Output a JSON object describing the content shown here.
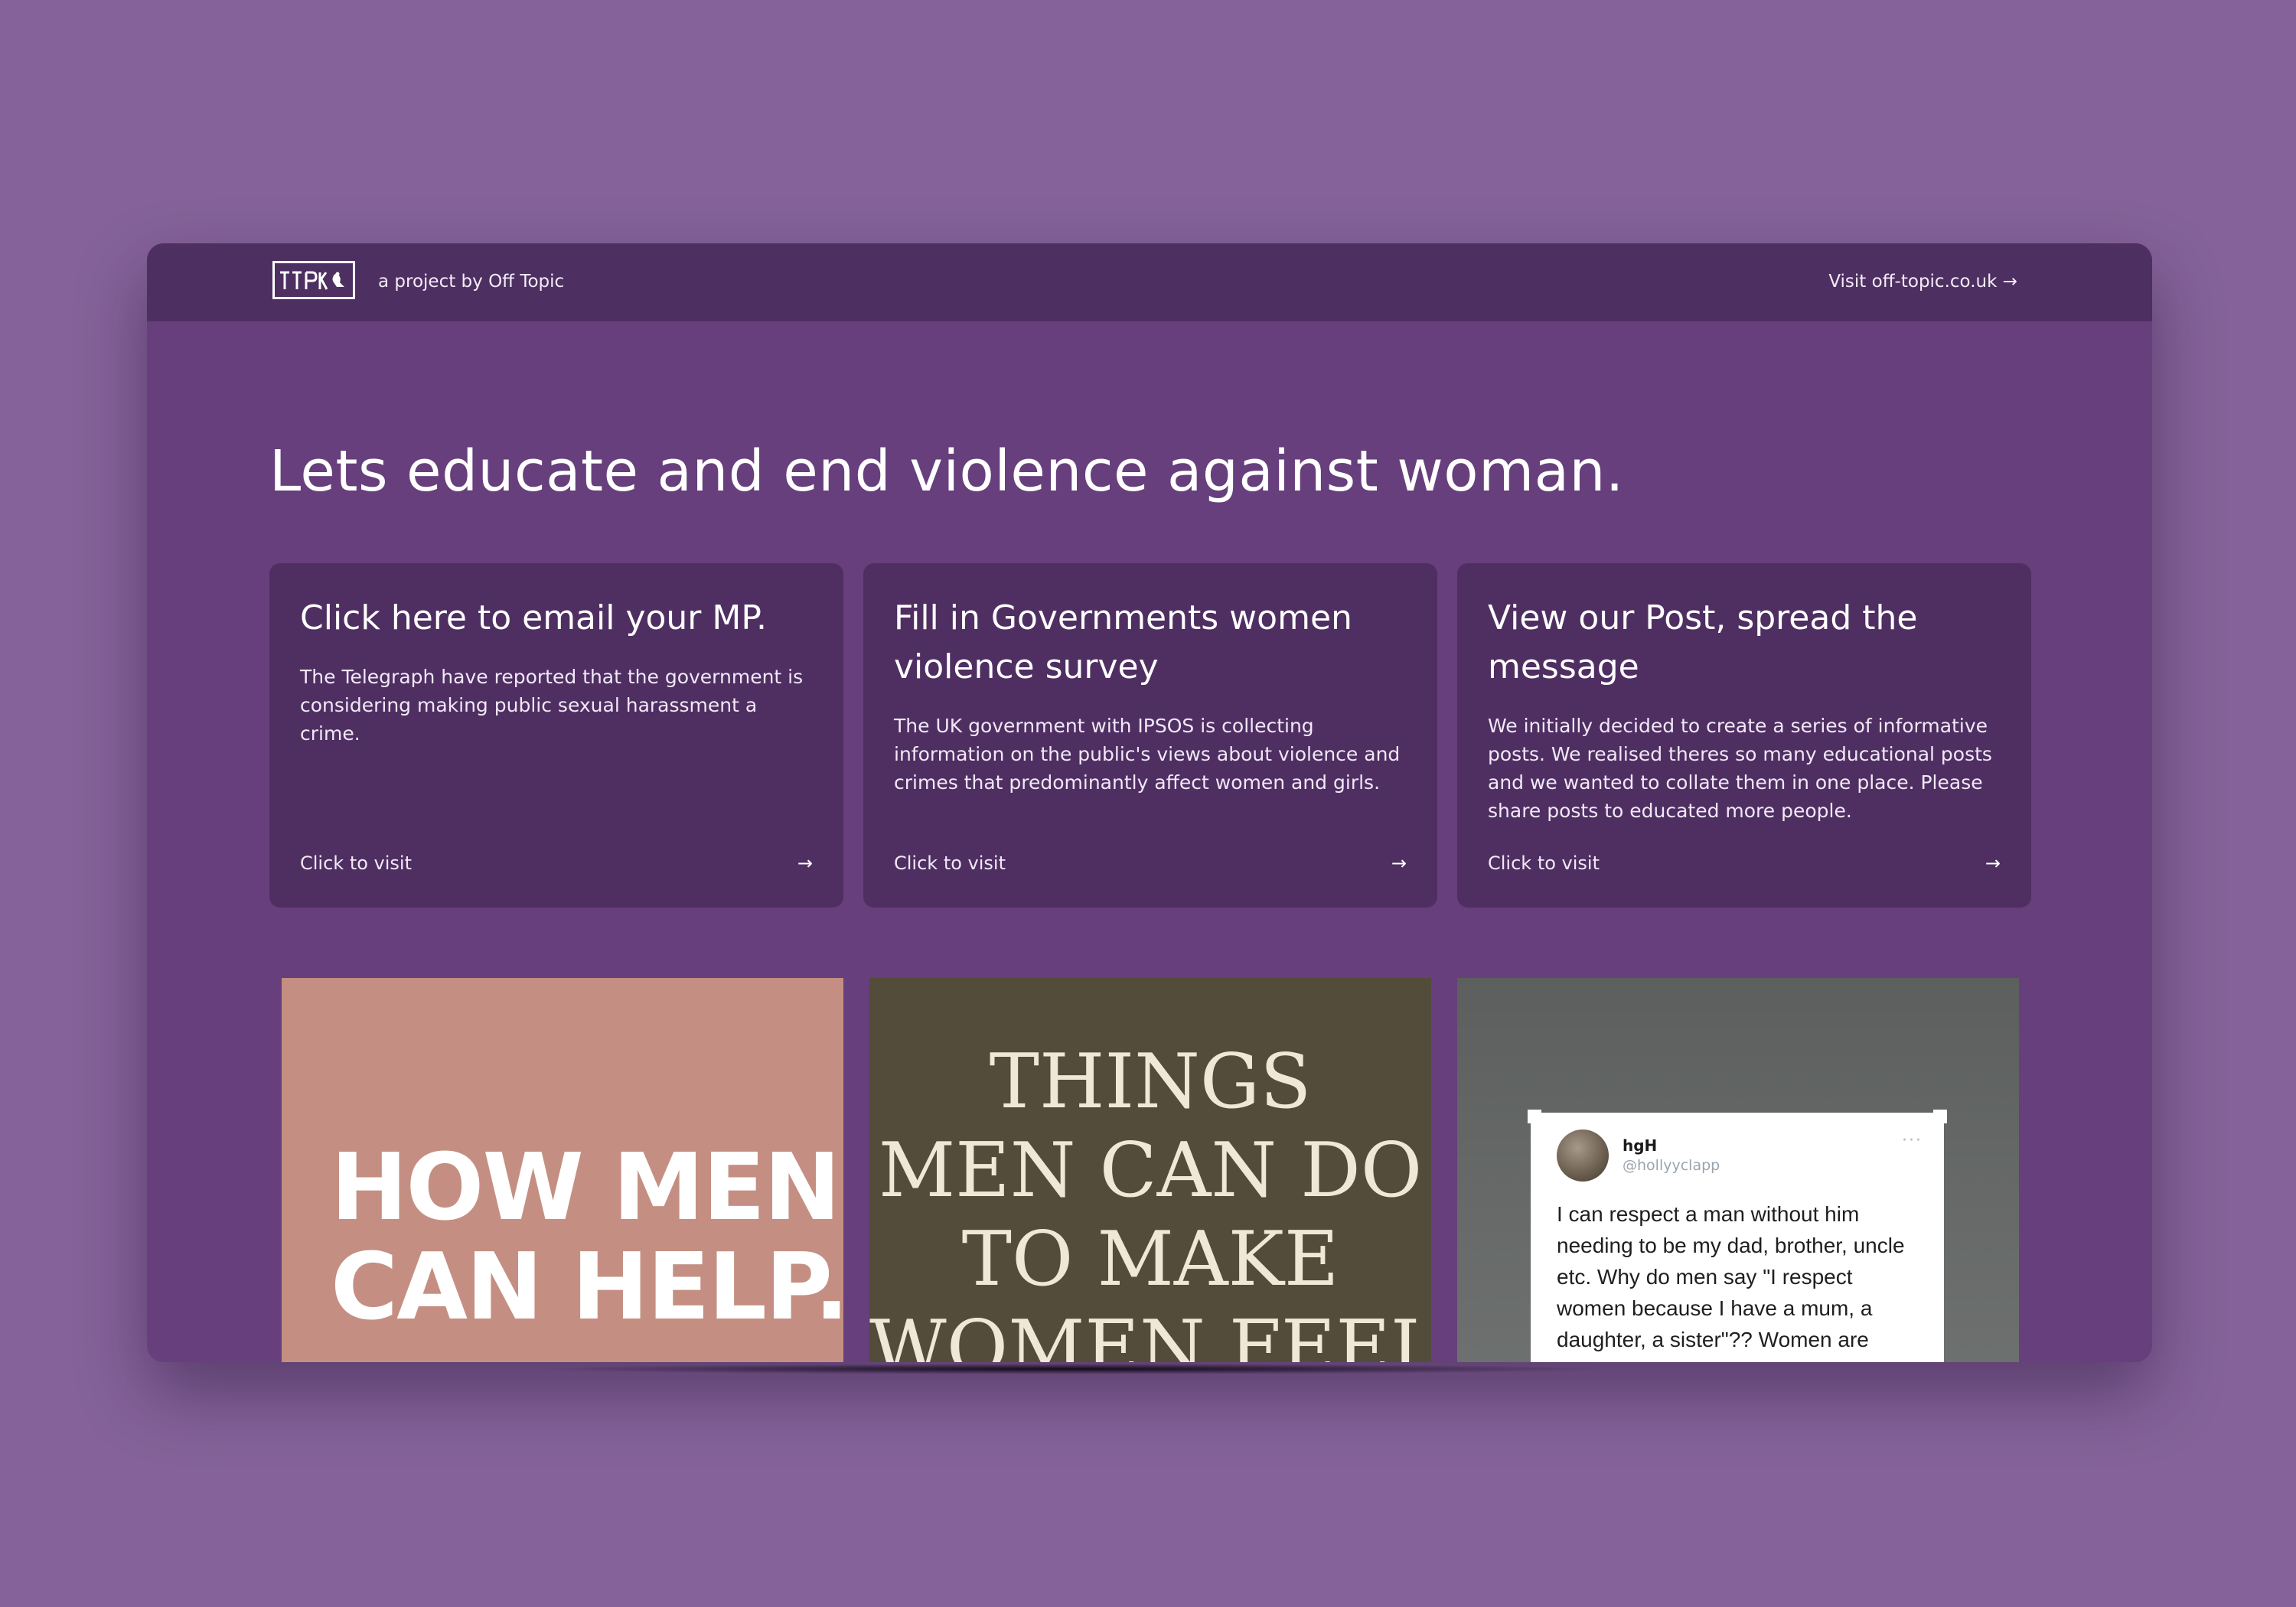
{
  "header": {
    "logo_alt": "Off Topic logo",
    "byline": "a project by Off Topic",
    "visit_link": "Visit off-topic.co.uk →"
  },
  "headline": "Lets educate and end violence against woman.",
  "cards": [
    {
      "title": "Click here to email your MP.",
      "body": "The Telegraph have reported that the government is considering making public sexual harassment a crime.",
      "cta": "Click to visit",
      "arrow": "→"
    },
    {
      "title": "Fill in Governments women violence survey",
      "body": "The UK government with IPSOS is collecting information on the public's views about violence and crimes that predominantly affect women and girls.",
      "cta": "Click to visit",
      "arrow": "→"
    },
    {
      "title": "View our Post, spread the message",
      "body": "We initially decided to create a series of informative posts. We realised theres so many educational posts and we wanted to collate them in one place. Please share posts to educated more people.",
      "cta": "Click to visit",
      "arrow": "→"
    }
  ],
  "posts": [
    {
      "text": "HOW MEN\nCAN HELP.",
      "background": "#c48f82"
    },
    {
      "text": "THINGS\nMEN CAN DO\nTO MAKE\nWOMEN FEEL",
      "background": "#534c3b"
    },
    {
      "tweet": {
        "name": "hgH",
        "handle": "@hollyyclapp",
        "more": "···",
        "text": "I can respect a man without him needing to be my dad, brother, uncle etc. Why do men say \"I respect women because I have a mum, a daughter, a sister\"?? Women are people"
      }
    }
  ],
  "colors": {
    "page_background": "#85639a",
    "window_background": "#673f7c",
    "topbar": "#4e2f62",
    "card": "#4f2f62",
    "text": "#ffffff"
  },
  "icons": {
    "logo": "off-topic-logo",
    "card_arrow": "arrow-right-icon",
    "tweet_more": "more-dots-icon"
  }
}
